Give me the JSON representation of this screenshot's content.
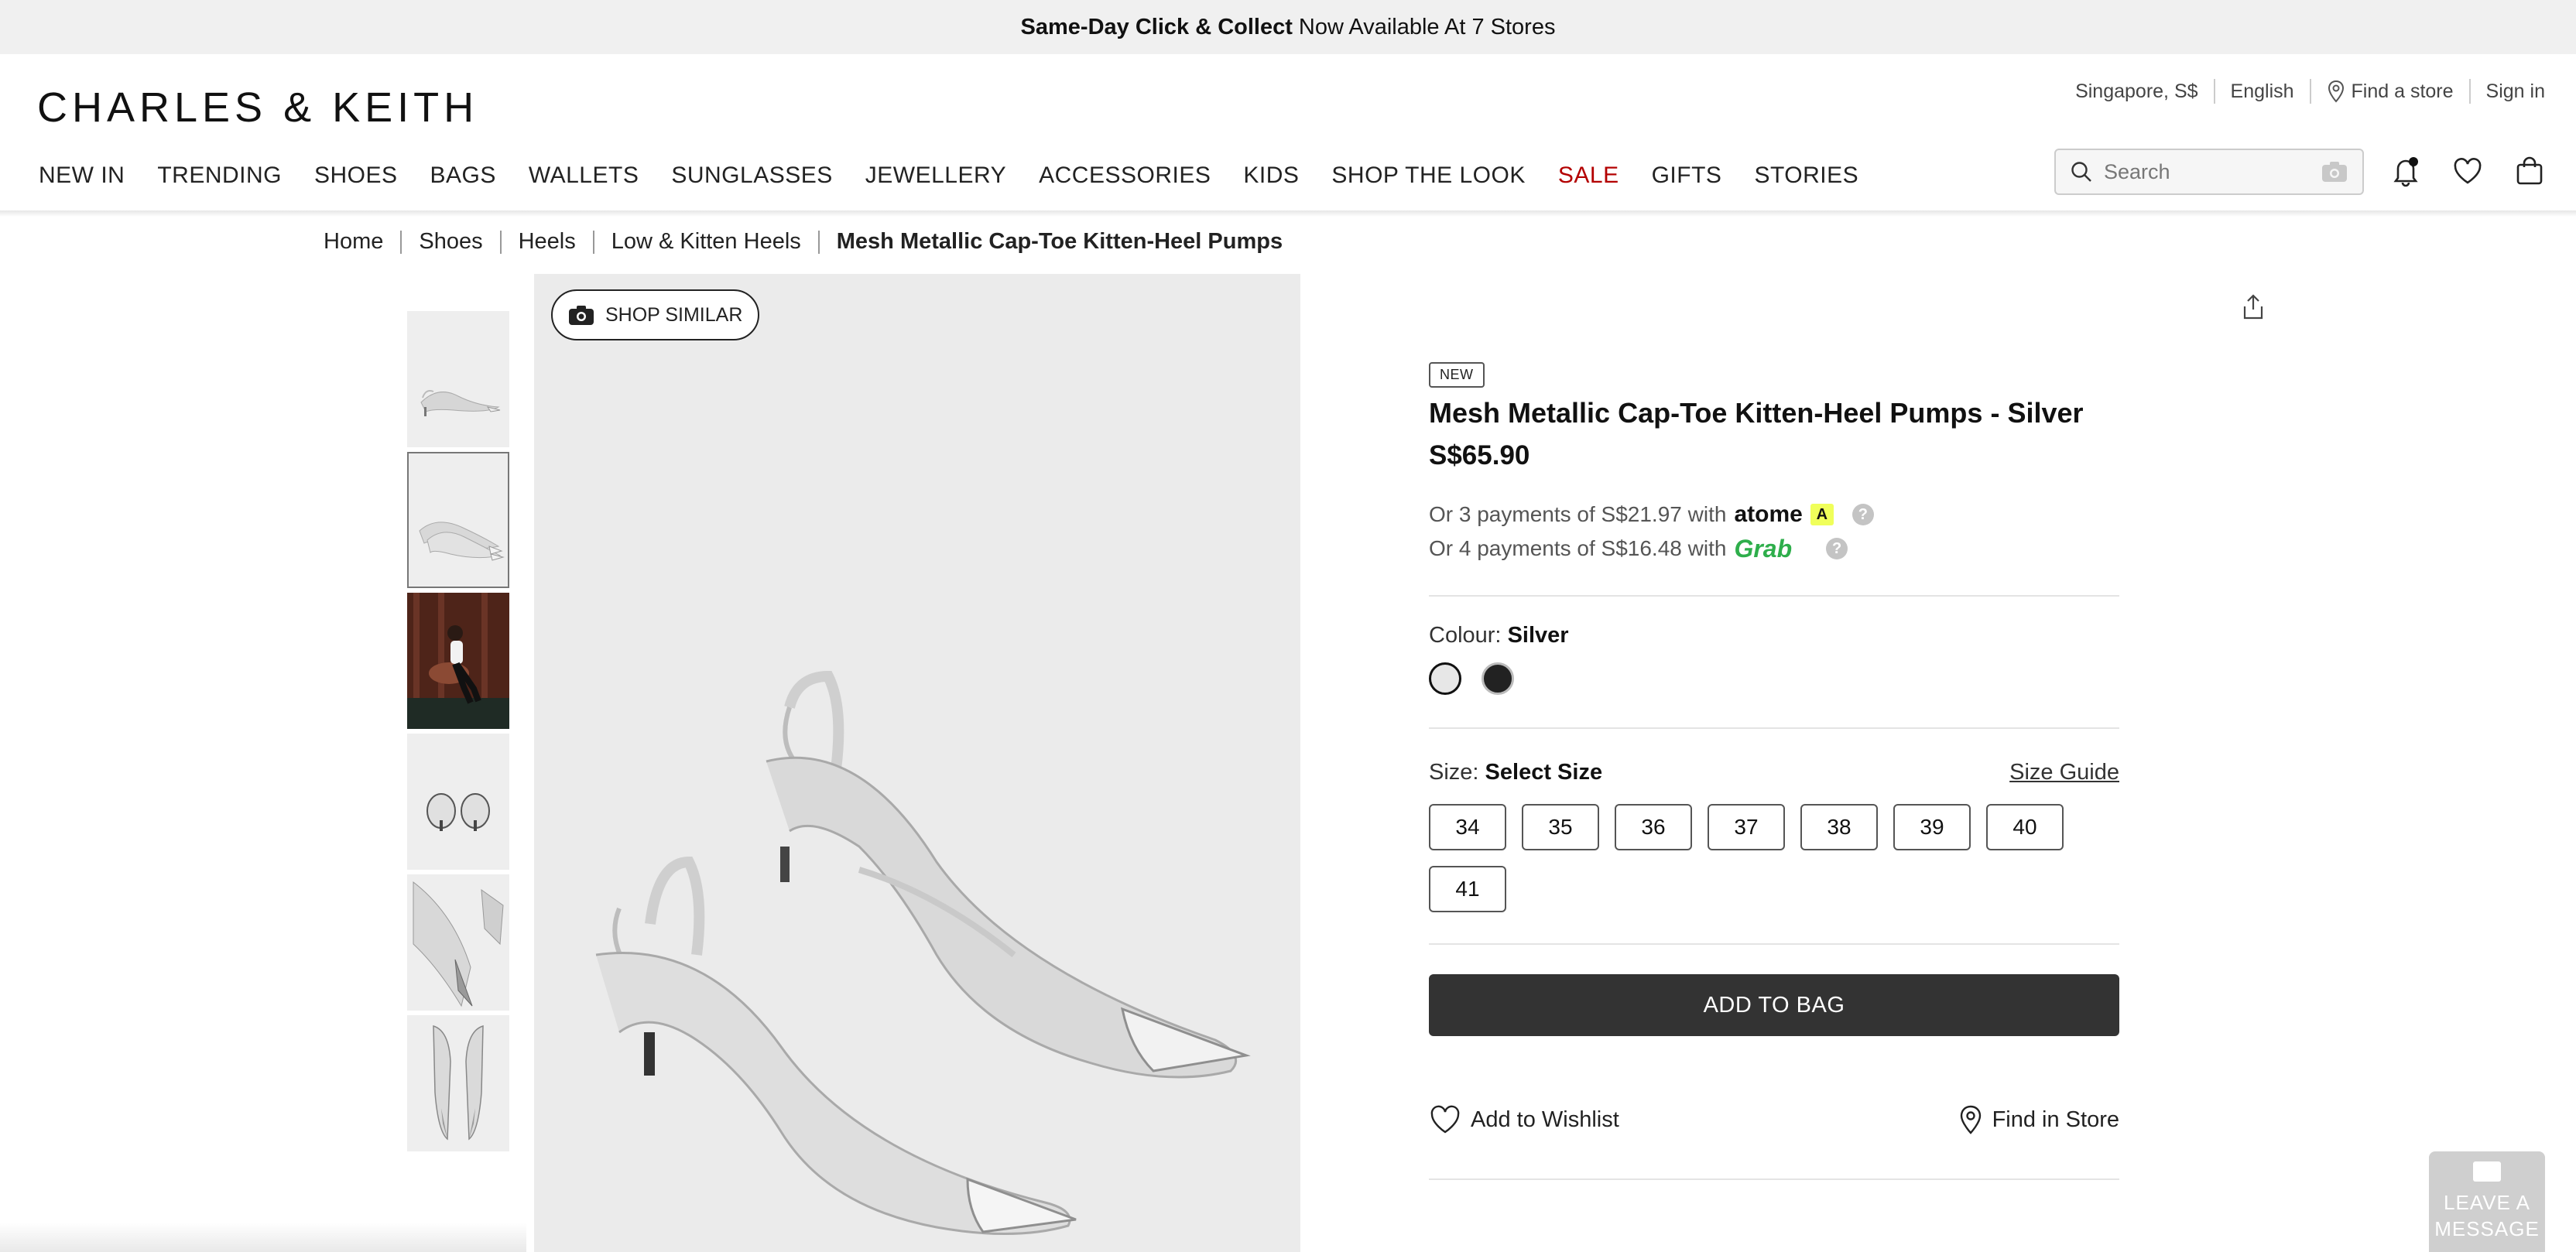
{
  "promo": {
    "bold": "Same-Day Click & Collect",
    "rest": "Now Available At 7 Stores"
  },
  "header": {
    "logo": "CHARLES & KEITH",
    "region": "Singapore, S$",
    "language": "English",
    "find_store": "Find a store",
    "sign_in": "Sign in",
    "search_placeholder": "Search"
  },
  "nav": {
    "items": [
      "NEW IN",
      "TRENDING",
      "SHOES",
      "BAGS",
      "WALLETS",
      "SUNGLASSES",
      "JEWELLERY",
      "ACCESSORIES",
      "KIDS",
      "SHOP THE LOOK",
      "SALE",
      "GIFTS",
      "STORIES"
    ]
  },
  "breadcrumbs": [
    "Home",
    "Shoes",
    "Heels",
    "Low & Kitten Heels",
    "Mesh Metallic Cap-Toe Kitten-Heel Pumps"
  ],
  "gallery": {
    "shop_similar": "SHOP SIMILAR"
  },
  "product": {
    "badge": "NEW",
    "title": "Mesh Metallic Cap-Toe Kitten-Heel Pumps - Silver",
    "price": "S$65.90",
    "atome_text": "Or 3 payments of S$21.97 with",
    "atome_brand": "atome",
    "grab_text": "Or 4 payments of S$16.48 with",
    "grab_brand": "Grab",
    "colour_label": "Colour:",
    "colour_value": "Silver",
    "size_label": "Size:",
    "size_value": "Select Size",
    "size_guide": "Size Guide",
    "sizes": [
      "34",
      "35",
      "36",
      "37",
      "38",
      "39",
      "40",
      "41"
    ],
    "add_to_bag": "ADD TO BAG",
    "wishlist": "Add to Wishlist",
    "find_in_store": "Find in Store"
  },
  "chat": {
    "line1": "LEAVE A",
    "line2": "MESSAGE"
  },
  "colors": {
    "sale": "#b30000",
    "button": "#333333",
    "grab": "#2eae4b",
    "atome_mark": "#f0ff5a"
  }
}
